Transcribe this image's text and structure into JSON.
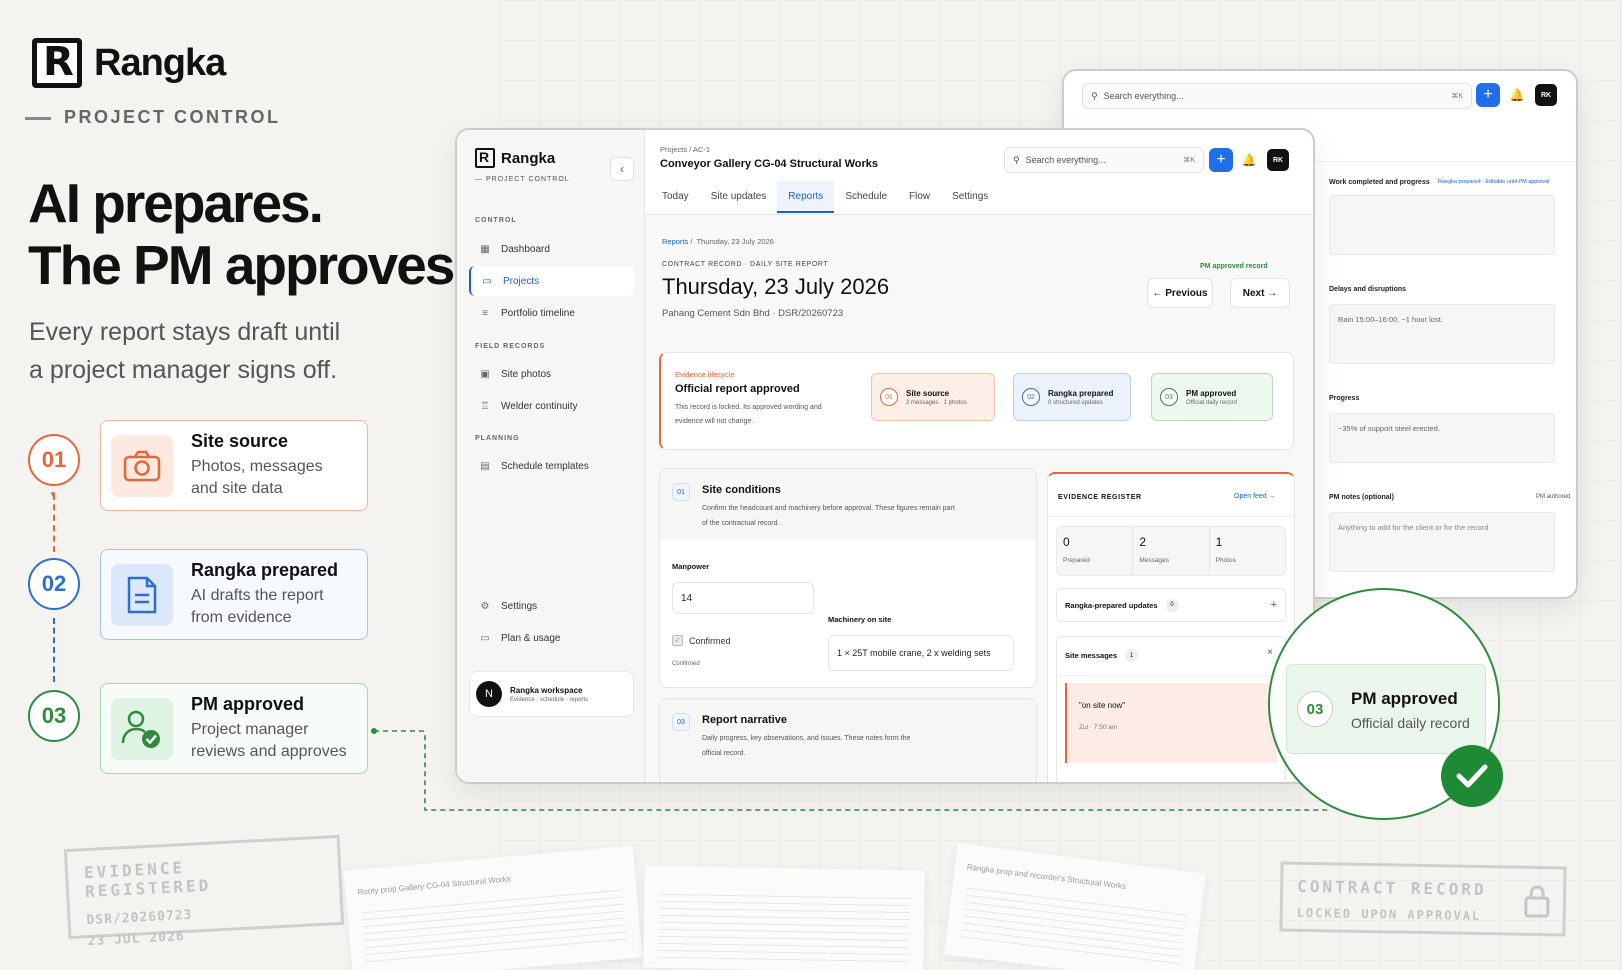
{
  "brand": {
    "name": "Rangka",
    "subtitle": "PROJECT CONTROL"
  },
  "hero": {
    "title_line1": "AI prepares.",
    "title_line2": "The PM approves.",
    "subtitle_line1": "Every report stays draft until",
    "subtitle_line2": "a project manager signs off."
  },
  "steps": [
    {
      "num": "01",
      "title": "Site source",
      "desc1": "Photos, messages",
      "desc2": "and site data",
      "color": "#e8653a",
      "icon": "camera-icon"
    },
    {
      "num": "02",
      "title": "Rangka prepared",
      "desc1": "AI drafts the report",
      "desc2": "from evidence",
      "color": "#2b6fd6",
      "icon": "document-icon"
    },
    {
      "num": "03",
      "title": "PM approved",
      "desc1": "Project manager",
      "desc2": "reviews and approves",
      "color": "#2e8b3e",
      "icon": "user-check-icon"
    }
  ],
  "app": {
    "logo": "Rangka",
    "logo_sub": "PROJECT CONTROL",
    "sections": {
      "control": "CONTROL",
      "field": "FIELD RECORDS",
      "planning": "PLANNING"
    },
    "nav": {
      "dashboard": "Dashboard",
      "projects": "Projects",
      "portfolio": "Portfolio timeline",
      "photos": "Site photos",
      "welder": "Welder continuity",
      "templates": "Schedule templates",
      "settings": "Settings",
      "plan": "Plan & usage"
    },
    "workspace": {
      "initial": "N",
      "name": "Rangka workspace",
      "desc": "Evidence · schedule · reports"
    },
    "breadcrumb1": "Projects",
    "breadcrumb_sep": "/",
    "breadcrumb2": "AC-1",
    "project_title": "Conveyor Gallery CG-04 Structural Works",
    "search_placeholder": "Search everything...",
    "search_kbd": "⌘K",
    "avatar": "RK",
    "tabs": [
      "Today",
      "Site updates",
      "Reports",
      "Schedule",
      "Flow",
      "Settings"
    ],
    "report": {
      "crumb1": "Reports",
      "crumb2": "Thursday, 23 July 2026",
      "kicker": "CONTRACT RECORD · DAILY SITE REPORT",
      "status": "PM approved record",
      "date": "Thursday, 23 July 2026",
      "meta": "Pahang Cement Sdn Bhd · DSR/20260723",
      "prev": "← Previous",
      "next": "Next →"
    },
    "lifecycle": {
      "label": "Evidence lifecycle",
      "title": "Official report approved",
      "desc1": "This record is locked. Its approved wording and",
      "desc2": "evidence will not change.",
      "chips": [
        {
          "n": "01",
          "t": "Site source",
          "d": "2 messages · 1 photos"
        },
        {
          "n": "02",
          "t": "Rangka prepared",
          "d": "0 structured updates"
        },
        {
          "n": "03",
          "t": "PM approved",
          "d": "Official daily record"
        }
      ]
    },
    "conditions": {
      "n": "01",
      "title": "Site conditions",
      "desc1": "Confirm the headcount and machinery before approval. These figures remain part",
      "desc2": "of the contractual record.",
      "manpower_label": "Manpower",
      "manpower": "14",
      "confirmed": "Confirmed",
      "confirmed_small": "Confirmed",
      "machinery_label": "Machinery on site",
      "machinery": "1 × 25T mobile crane, 2 x welding sets"
    },
    "narrative": {
      "n": "03",
      "title": "Report narrative",
      "desc1": "Daily progress, key observations, and issues. These notes form the",
      "desc2": "official record."
    },
    "register": {
      "title": "EVIDENCE REGISTER",
      "link": "Open feed →",
      "stats": [
        {
          "v": "0",
          "l": "Prepared"
        },
        {
          "v": "2",
          "l": "Messages"
        },
        {
          "v": "1",
          "l": "Photos"
        }
      ],
      "updates": "Rangka-prepared updates",
      "updates_count": "0",
      "messages": "Site messages",
      "messages_count": "1",
      "quote": "\"on site now\"",
      "quote_meta": "Zul · 7:50 am"
    }
  },
  "back_window": {
    "search_placeholder": "Search everything...",
    "search_kbd": "⌘K",
    "avatar": "RK",
    "work_label": "Work completed and progress",
    "work_note": "Rangka prepared · Editable until PM approval",
    "delays_label": "Delays and disruptions",
    "delays_value": "Rain 15:00–16:00, ~1 hour lost.",
    "progress_label": "Progress",
    "progress_value": "~35% of support steel erected.",
    "notes_label": "PM notes (optional)",
    "notes_tag": "PM authored",
    "notes_placeholder": "Anything to add for the client or for the record"
  },
  "zoom": {
    "n": "03",
    "title": "PM approved",
    "desc": "Official daily record"
  },
  "stamps": {
    "left1": "EVIDENCE REGISTERED",
    "left2": "DSR/20260723",
    "left3": "23 JUL 2026",
    "right1": "CONTRACT RECORD",
    "right2": "LOCKED UPON APPROVAL"
  },
  "papers": {
    "p1": "Rooty prop Gallery CG-04 Structural Works",
    "p3": "Rangka prop and recorder's Structural Works"
  },
  "colors": {
    "accent": "#1f6feb",
    "orange": "#e8653a",
    "blue": "#2b6fd6",
    "green": "#2e8b3e"
  }
}
